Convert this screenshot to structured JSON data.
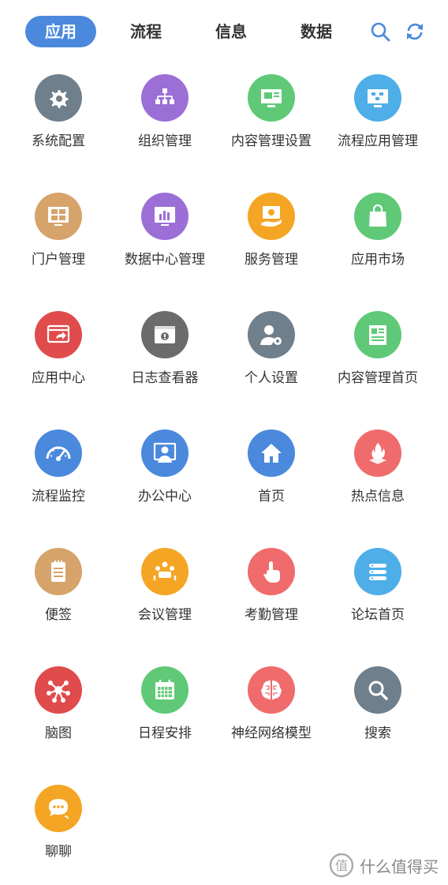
{
  "tabs": [
    {
      "label": "应用",
      "active": true
    },
    {
      "label": "流程",
      "active": false
    },
    {
      "label": "信息",
      "active": false
    },
    {
      "label": "数据",
      "active": false
    }
  ],
  "toolbar": {
    "search_icon": "search-icon",
    "refresh_icon": "refresh-icon"
  },
  "apps": [
    {
      "label": "系统配置",
      "icon": "gear-icon",
      "color": "#6f7f8c"
    },
    {
      "label": "组织管理",
      "icon": "org-chart-icon",
      "color": "#9b6fd6"
    },
    {
      "label": "内容管理设置",
      "icon": "content-monitor-icon",
      "color": "#5fc977"
    },
    {
      "label": "流程应用管理",
      "icon": "flow-monitor-icon",
      "color": "#4eaee8"
    },
    {
      "label": "门户管理",
      "icon": "portal-grid-icon",
      "color": "#d6a36a"
    },
    {
      "label": "数据中心管理",
      "icon": "bar-chart-monitor-icon",
      "color": "#9b6fd6"
    },
    {
      "label": "服务管理",
      "icon": "service-hand-icon",
      "color": "#f5a524"
    },
    {
      "label": "应用市场",
      "icon": "shopping-bag-icon",
      "color": "#5fc977"
    },
    {
      "label": "应用中心",
      "icon": "app-window-share-icon",
      "color": "#e04b4b"
    },
    {
      "label": "日志查看器",
      "icon": "log-window-icon",
      "color": "#6b6b6b"
    },
    {
      "label": "个人设置",
      "icon": "user-settings-icon",
      "color": "#6f7f8c"
    },
    {
      "label": "内容管理首页",
      "icon": "newspaper-icon",
      "color": "#5fc977"
    },
    {
      "label": "流程监控",
      "icon": "speedometer-icon",
      "color": "#4a89dc"
    },
    {
      "label": "办公中心",
      "icon": "office-user-icon",
      "color": "#4a89dc"
    },
    {
      "label": "首页",
      "icon": "home-icon",
      "color": "#4a89dc"
    },
    {
      "label": "热点信息",
      "icon": "flame-icon",
      "color": "#f06b6b"
    },
    {
      "label": "便签",
      "icon": "notepad-icon",
      "color": "#d6a36a"
    },
    {
      "label": "会议管理",
      "icon": "meeting-icon",
      "color": "#f5a524"
    },
    {
      "label": "考勤管理",
      "icon": "tap-finger-icon",
      "color": "#f06b6b"
    },
    {
      "label": "论坛首页",
      "icon": "forum-list-icon",
      "color": "#4eaee8"
    },
    {
      "label": "脑图",
      "icon": "mind-map-icon",
      "color": "#e04b4b"
    },
    {
      "label": "日程安排",
      "icon": "calendar-icon",
      "color": "#5fc977"
    },
    {
      "label": "神经网络模型",
      "icon": "brain-icon",
      "color": "#f06b6b"
    },
    {
      "label": "搜索",
      "icon": "search-circle-icon",
      "color": "#6f7f8c"
    },
    {
      "label": "聊聊",
      "icon": "chat-bubble-icon",
      "color": "#f5a524"
    }
  ],
  "watermark": {
    "text": "什么值得买"
  }
}
